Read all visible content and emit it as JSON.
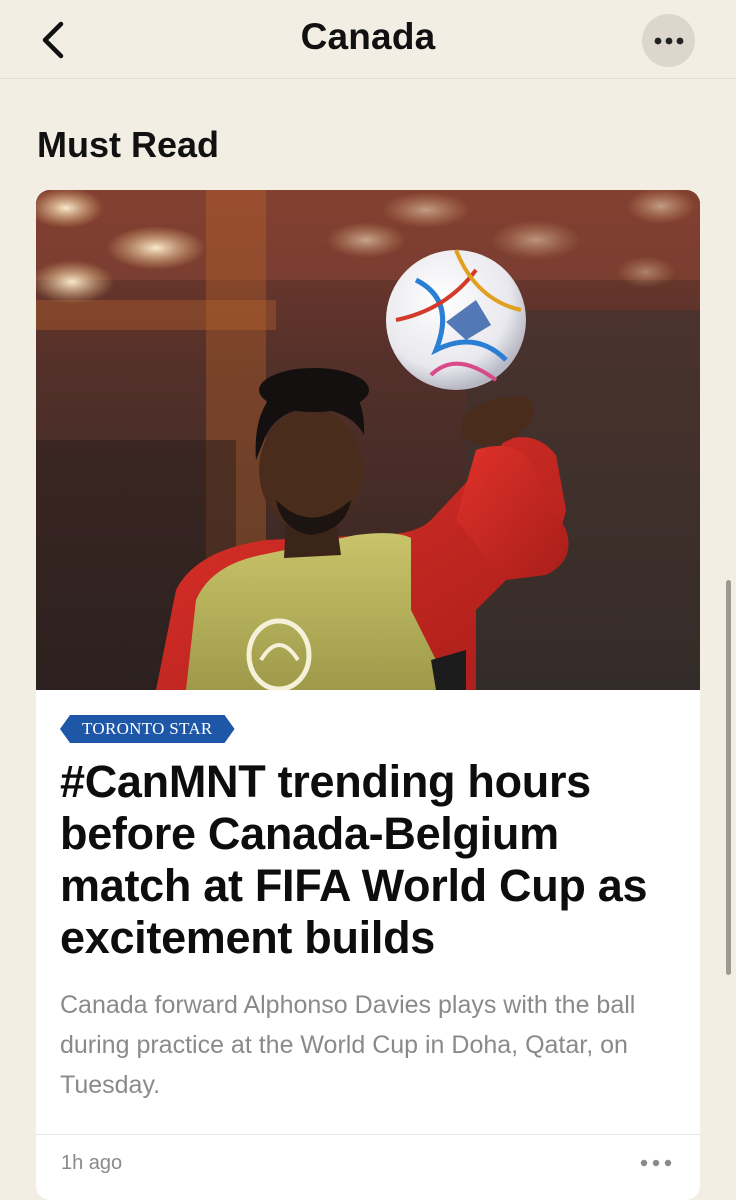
{
  "nav": {
    "title": "Canada",
    "back_icon": "chevron-left-icon",
    "more_icon": "ellipsis-icon"
  },
  "section": {
    "title": "Must Read"
  },
  "article": {
    "source": "TORONTO STAR",
    "headline": "#CanMNT trending hours before Canada-Belgium match at FIFA World Cup as excitement builds",
    "summary": "Canada forward Alphonso Davies plays with the ball during practice at the World Cup in Doha, Qatar, on Tuesday.",
    "timestamp": "1h ago",
    "more_icon": "ellipsis-icon"
  },
  "colors": {
    "background": "#f3eee4",
    "source_badge": "#1e56a8",
    "summary_text": "#8a8a8a"
  }
}
